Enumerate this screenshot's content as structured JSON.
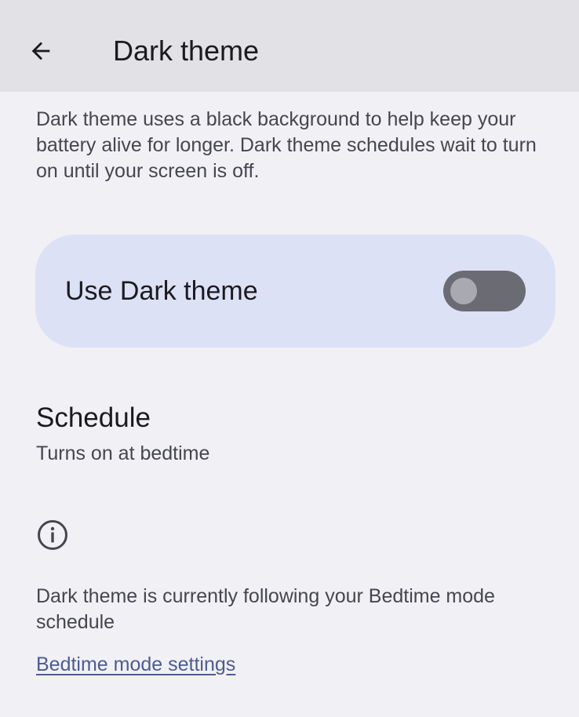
{
  "appbar": {
    "back_icon": "arrow-back-icon",
    "title": "Dark theme"
  },
  "description": "Dark theme uses a black background to help keep your battery alive for longer. Dark theme schedules wait to turn on until your screen is off.",
  "main_toggle": {
    "label": "Use Dark theme",
    "enabled": false,
    "card_color": "#dde1f6",
    "track_color": "#6b6b73",
    "thumb_color": "#a9a9b0"
  },
  "schedule": {
    "title": "Schedule",
    "summary": "Turns on at bedtime"
  },
  "footer": {
    "icon": "info-icon",
    "text": "Dark theme is currently following your Bedtime mode schedule",
    "link_label": "Bedtime mode settings",
    "link_color": "#4d5c92"
  }
}
